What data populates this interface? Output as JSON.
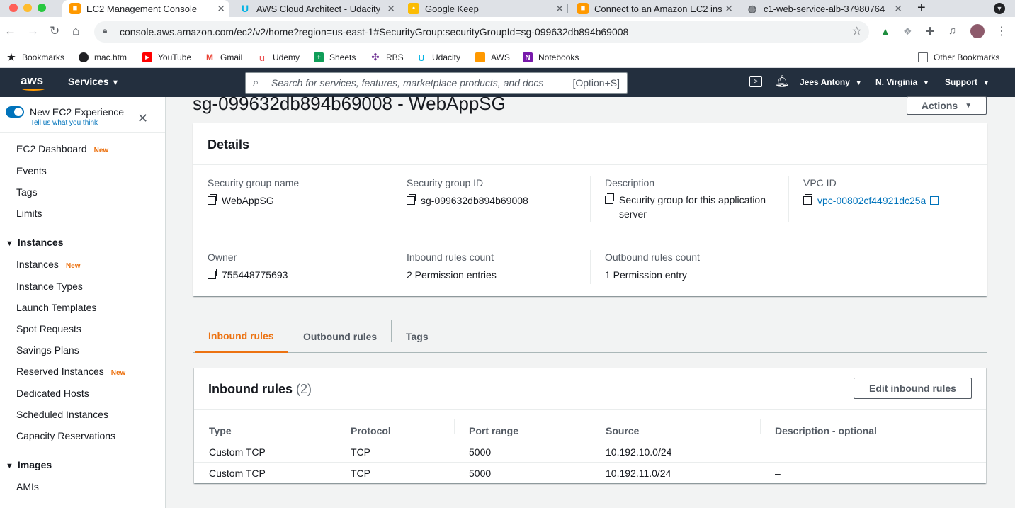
{
  "browser": {
    "tabs": [
      {
        "title": "EC2 Management Console",
        "active": true,
        "icon": "aws-cube-icon"
      },
      {
        "title": "AWS Cloud Architect - Udacity",
        "active": false,
        "icon": "udacity-icon"
      },
      {
        "title": "Google Keep",
        "active": false,
        "icon": "keep-icon"
      },
      {
        "title": "Connect to an Amazon EC2 ins",
        "active": false,
        "icon": "aws-cube-icon"
      },
      {
        "title": "c1-web-service-alb-37980764",
        "active": false,
        "icon": "globe-icon"
      }
    ],
    "url": "console.aws.amazon.com/ec2/v2/home?region=us-east-1#SecurityGroup:securityGroupId=sg-099632db894b69008",
    "bookmarks": [
      "Bookmarks",
      "mac.htm",
      "YouTube",
      "Gmail",
      "Udemy",
      "Sheets",
      "RBS",
      "Udacity",
      "AWS",
      "Notebooks"
    ],
    "other_bookmarks": "Other Bookmarks"
  },
  "aws_nav": {
    "logo": "aws",
    "services": "Services",
    "search_placeholder": "Search for services, features, marketplace products, and docs",
    "search_shortcut": "[Option+S]",
    "user": "Jees Antony",
    "region": "N. Virginia",
    "support": "Support"
  },
  "sidebar": {
    "experience_toggle": "New EC2 Experience",
    "experience_link": "Tell us what you think",
    "new_badge": "New",
    "top_items": [
      {
        "label": "EC2 Dashboard",
        "new": true
      },
      {
        "label": "Events",
        "new": false
      },
      {
        "label": "Tags",
        "new": false
      },
      {
        "label": "Limits",
        "new": false
      }
    ],
    "instances_section": "Instances",
    "instances_items": [
      {
        "label": "Instances",
        "new": true
      },
      {
        "label": "Instance Types",
        "new": false
      },
      {
        "label": "Launch Templates",
        "new": false
      },
      {
        "label": "Spot Requests",
        "new": false
      },
      {
        "label": "Savings Plans",
        "new": false
      },
      {
        "label": "Reserved Instances",
        "new": true
      },
      {
        "label": "Dedicated Hosts",
        "new": false
      },
      {
        "label": "Scheduled Instances",
        "new": false
      },
      {
        "label": "Capacity Reservations",
        "new": false
      }
    ],
    "images_section": "Images",
    "images_items": [
      {
        "label": "AMIs",
        "new": false
      }
    ]
  },
  "page": {
    "title": "sg-099632db894b69008 - WebAppSG",
    "actions": "Actions"
  },
  "details": {
    "header": "Details",
    "fields": {
      "sg_name_label": "Security group name",
      "sg_name": "WebAppSG",
      "sg_id_label": "Security group ID",
      "sg_id": "sg-099632db894b69008",
      "description_label": "Description",
      "description": "Security group for this application server",
      "vpc_label": "VPC ID",
      "vpc": "vpc-00802cf44921dc25a",
      "owner_label": "Owner",
      "owner": "755448775693",
      "inbound_count_label": "Inbound rules count",
      "inbound_count": "2 Permission entries",
      "outbound_count_label": "Outbound rules count",
      "outbound_count": "1 Permission entry"
    }
  },
  "rule_tabs": [
    "Inbound rules",
    "Outbound rules",
    "Tags"
  ],
  "inbound": {
    "title": "Inbound rules",
    "count": "(2)",
    "edit_button": "Edit inbound rules",
    "columns": [
      "Type",
      "Protocol",
      "Port range",
      "Source",
      "Description - optional"
    ],
    "rows": [
      [
        "Custom TCP",
        "TCP",
        "5000",
        "10.192.10.0/24",
        "–"
      ],
      [
        "Custom TCP",
        "TCP",
        "5000",
        "10.192.11.0/24",
        "–"
      ]
    ]
  },
  "colors": {
    "aws_nav_bg": "#232f3e",
    "accent_orange": "#ec7211",
    "link_blue": "#0073bb"
  }
}
